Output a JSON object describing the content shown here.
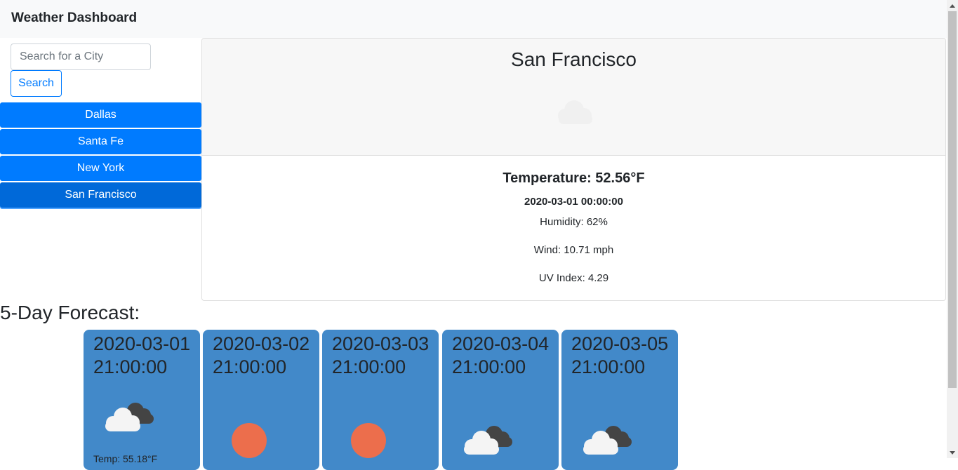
{
  "header": {
    "title": "Weather Dashboard"
  },
  "search": {
    "placeholder": "Search for a City",
    "value": "",
    "button_label": "Search"
  },
  "cities": [
    {
      "label": "Dallas",
      "active": false
    },
    {
      "label": "Santa Fe",
      "active": false
    },
    {
      "label": "New York",
      "active": false
    },
    {
      "label": "San Francisco",
      "active": true
    }
  ],
  "current": {
    "city": "San Francisco",
    "icon": "cloud-icon",
    "temperature": "Temperature: 52.56°F",
    "date": "2020-03-01 00:00:00",
    "humidity": "Humidity: 62%",
    "wind": "Wind: 10.71 mph",
    "uv": "UV Index: 4.29"
  },
  "forecast": {
    "heading": "5-Day Forecast:",
    "days": [
      {
        "date": "2020-03-01 21:00:00",
        "icon": "partly-cloudy-icon",
        "temp": "Temp: 55.18°F"
      },
      {
        "date": "2020-03-02 21:00:00",
        "icon": "sun-icon"
      },
      {
        "date": "2020-03-03 21:00:00",
        "icon": "sun-icon"
      },
      {
        "date": "2020-03-04 21:00:00",
        "icon": "partly-cloudy-icon"
      },
      {
        "date": "2020-03-05 21:00:00",
        "icon": "partly-cloudy-icon"
      }
    ]
  },
  "colors": {
    "accent": "#007bff",
    "active_city": "#0069d9",
    "forecast_card": "#4289c9",
    "sun": "#ec6e4c",
    "dark_cloud": "#444444",
    "light_cloud": "#f4f4f4"
  }
}
